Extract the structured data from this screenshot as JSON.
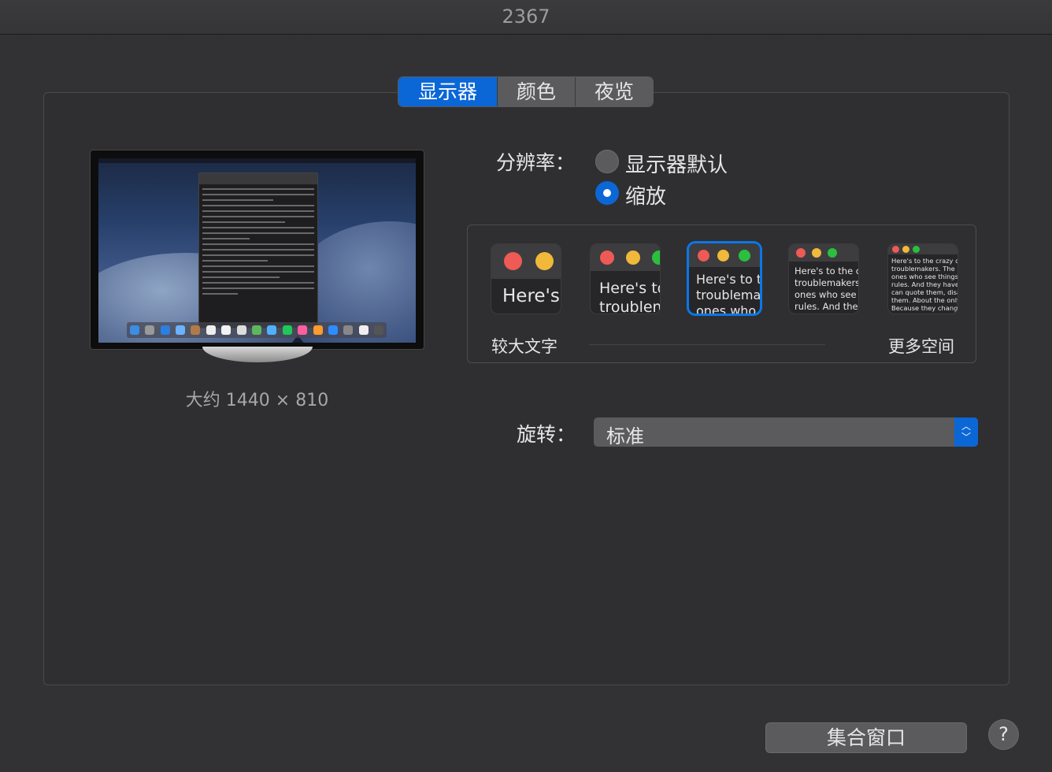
{
  "window": {
    "title": "2367"
  },
  "tabs": [
    {
      "label": "显示器",
      "active": true
    },
    {
      "label": "颜色",
      "active": false
    },
    {
      "label": "夜览",
      "active": false
    }
  ],
  "preview": {
    "caption": "大约 1440 × 810"
  },
  "resolution": {
    "label": "分辨率：",
    "options": [
      {
        "label": "显示器默认",
        "selected": false
      },
      {
        "label": "缩放",
        "selected": true
      }
    ]
  },
  "scaling": {
    "thumbnails": [
      {
        "text": "Here's",
        "selected": false
      },
      {
        "text": "Here's to\ntroublem",
        "selected": false
      },
      {
        "text": "Here's to t\ntroublema\nones who",
        "selected": true
      },
      {
        "text": "Here's to the cr\ntroublemakers.\nones who see t\nrules. And they",
        "selected": false
      },
      {
        "text": "Here's to the crazy one\ntroublemakers. The rou\nones who see things dif\nrules. And they have no\ncan quote them, disagre\nthem. About the only th\nBecause they change t",
        "selected": false
      }
    ],
    "left_label": "较大文字",
    "right_label": "更多空间"
  },
  "rotation": {
    "label": "旋转：",
    "value": "标准"
  },
  "buttons": {
    "gather_windows": "集合窗口",
    "help": "?"
  },
  "colors": {
    "accent": "#0b67d6",
    "traffic_red": "#ee5a55",
    "traffic_yellow": "#f0b93a",
    "traffic_green": "#2bbf3f"
  }
}
